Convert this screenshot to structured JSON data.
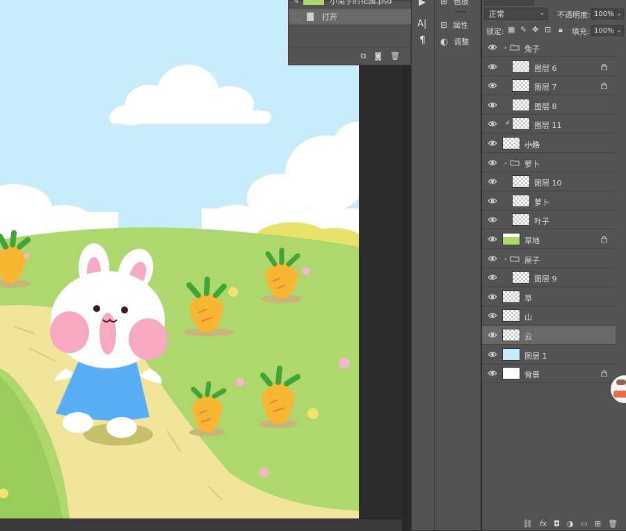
{
  "history": {
    "top_item": "小兔子的花园.psd",
    "open_label": "打开"
  },
  "mid_panels": {
    "swatches": "色板",
    "properties": "属性",
    "adjustments": "调整"
  },
  "layers_panel": {
    "blend_mode": "正常",
    "opacity_label": "不透明度:",
    "opacity_value": "100%",
    "lock_label": "锁定:",
    "fill_label": "填充:",
    "fill_value": "100%",
    "layers": [
      {
        "name": "兔子",
        "type": "group",
        "indent": 0,
        "locked": false
      },
      {
        "name": "图层 6",
        "type": "layer",
        "indent": 1,
        "locked": true,
        "thumb": "transparent"
      },
      {
        "name": "图层 7",
        "type": "layer",
        "indent": 1,
        "locked": true,
        "thumb": "transparent"
      },
      {
        "name": "图层 8",
        "type": "layer",
        "indent": 1,
        "locked": false,
        "thumb": "transparent"
      },
      {
        "name": "图层 11",
        "type": "layer",
        "indent": 1,
        "locked": false,
        "thumb": "transparent",
        "clip": true
      },
      {
        "name": "小路",
        "type": "layer",
        "indent": 0,
        "locked": false,
        "thumb": "transparent",
        "strike": true
      },
      {
        "name": "萝卜",
        "type": "group",
        "indent": 0,
        "locked": false
      },
      {
        "name": "图层 10",
        "type": "layer",
        "indent": 1,
        "locked": false,
        "thumb": "transparent"
      },
      {
        "name": "萝卜",
        "type": "layer",
        "indent": 1,
        "locked": false,
        "thumb": "transparent"
      },
      {
        "name": "叶子",
        "type": "layer",
        "indent": 1,
        "locked": false,
        "thumb": "transparent"
      },
      {
        "name": "草地",
        "type": "layer",
        "indent": 0,
        "locked": true,
        "thumb": "grass"
      },
      {
        "name": "屋子",
        "type": "group",
        "indent": 0,
        "locked": false
      },
      {
        "name": "图层 9",
        "type": "layer",
        "indent": 1,
        "locked": false,
        "thumb": "transparent"
      },
      {
        "name": "草",
        "type": "layer",
        "indent": 0,
        "locked": false,
        "thumb": "transparent"
      },
      {
        "name": "山",
        "type": "layer",
        "indent": 0,
        "locked": false,
        "thumb": "transparent"
      },
      {
        "name": "云",
        "type": "layer",
        "indent": 0,
        "locked": false,
        "thumb": "transparent",
        "selected": true
      },
      {
        "name": "图层 1",
        "type": "layer",
        "indent": 0,
        "locked": false,
        "thumb": "sky"
      },
      {
        "name": "背景",
        "type": "layer",
        "indent": 0,
        "locked": true,
        "thumb": "white"
      }
    ]
  },
  "colors": {
    "panel_bg": "#535353",
    "selected_row": "#696969",
    "sky": "#c9ecfb",
    "grass": "#aed86e",
    "path": "#f0e59a",
    "carrot": "#f7b733",
    "bunny_dress": "#5aaef5"
  }
}
